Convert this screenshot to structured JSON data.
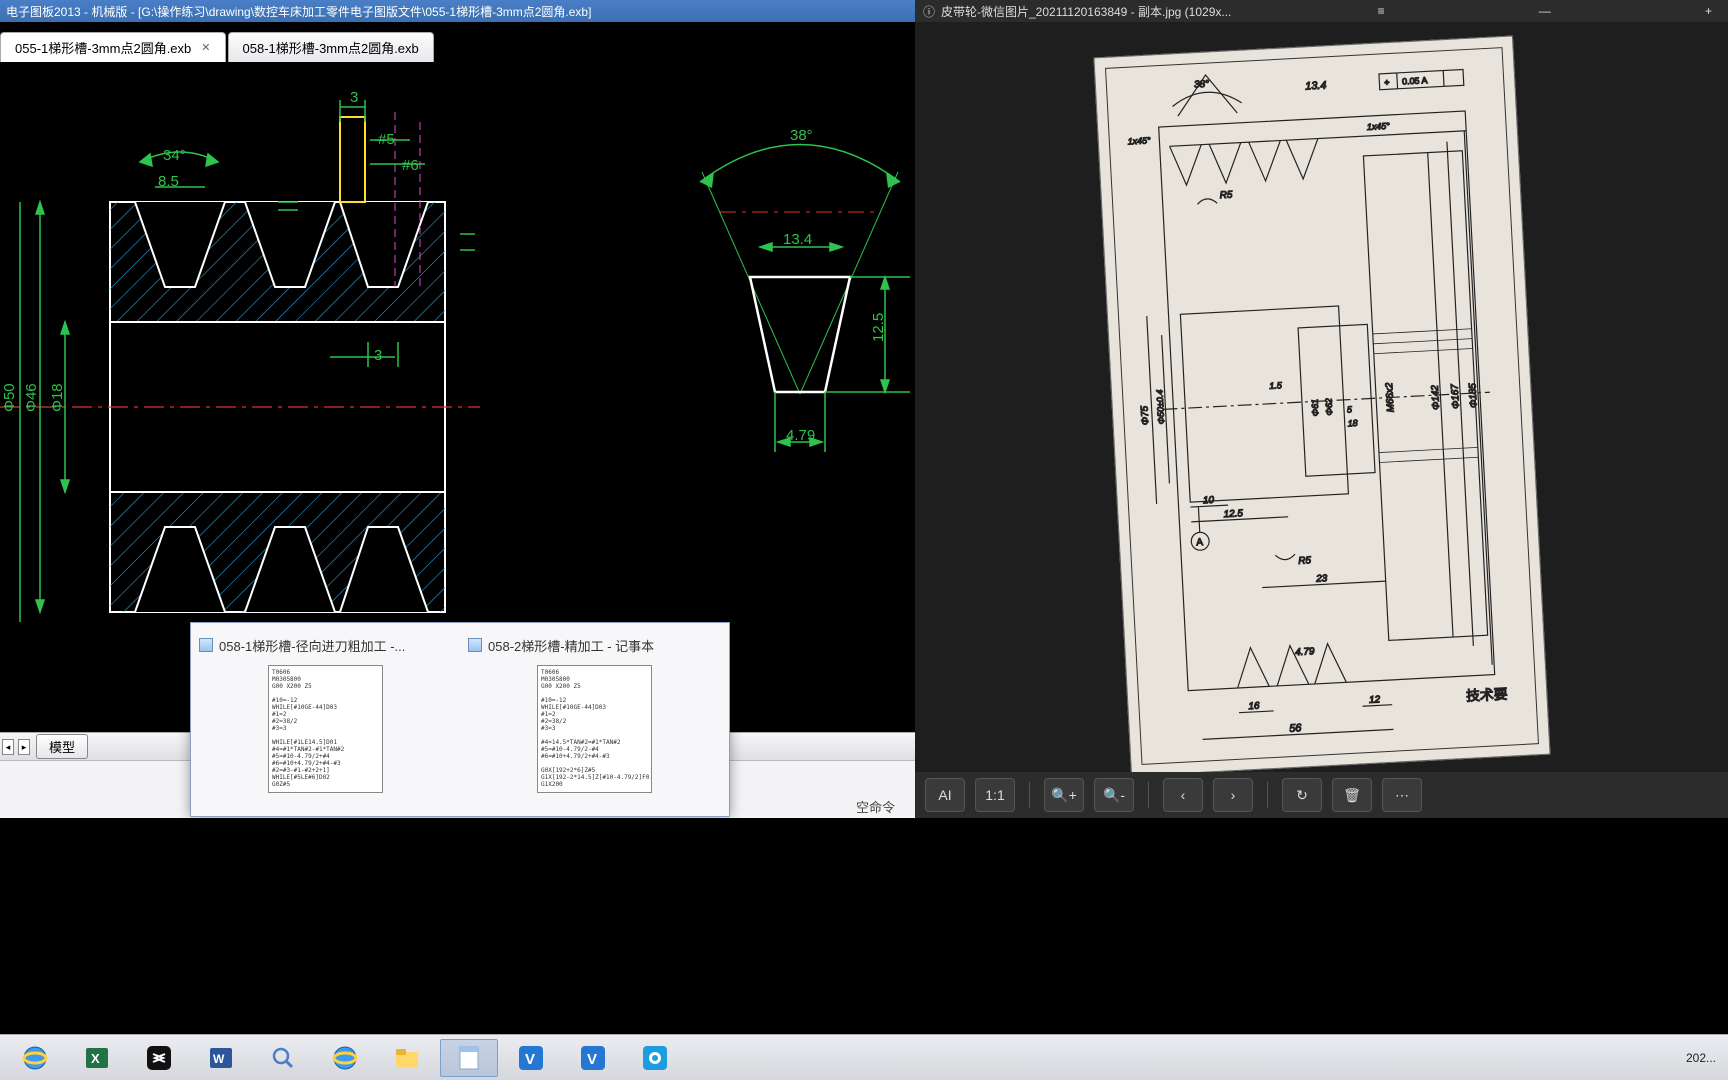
{
  "titlebar": {
    "left": "电子图板2013 - 机械版 - [G:\\操作练习\\drawing\\数控车床加工零件电子图版文件\\055-1梯形槽-3mm点2圆角.exb]",
    "right": "皮带轮-微信图片_20211120163849 - 副本.jpg (1029x..."
  },
  "tabs": [
    {
      "label": "055-1梯形槽-3mm点2圆角.exb",
      "active": true
    },
    {
      "label": "058-1梯形槽-3mm点2圆角.exb",
      "active": false
    }
  ],
  "modelbar": {
    "model_tab": "模型"
  },
  "cmdbar": {
    "label": "空命令"
  },
  "dimensions": {
    "d_top3": "3",
    "d_ph5": "#5",
    "d_ph6": "#6",
    "d_34": "34°",
    "d_85": "8.5",
    "d_38": "38°",
    "d_134": "13.4",
    "d_125": "12.5",
    "d_479": "4.79",
    "d_mid3": "3",
    "d_phi46": "Φ46",
    "d_phi50": "Φ50",
    "d_phi18": "Φ18"
  },
  "task_switcher": {
    "items": [
      {
        "title": "058-1梯形槽-径向进刀粗加工 -...",
        "code": "T0606\nM0305800\nG00 X200 Z5\n\n#10=-12\nWHILE[#10GE-44]D03\n#1=2\n#2=38/2\n#3=3\n\nWHILE[#1LE14.5]D01\n#4=#1*TAN#2-#1*TAN#2\n#5=#10-4.79/2+#4\n#6=#10+4.79/2+#4-#3\n#2=#3-#1-#2+2+1]\nWHILE[#5LE#6]D02\nG0Z#5"
      },
      {
        "title": "058-2梯形槽-精加工 - 记事本",
        "code": "T0606\nM0305800\nG00 X200 Z5\n\n#10=-12\nWHILE[#10GE-44]D03\n#1=2\n#2=38/2\n#3=3\n\n#4=14.5*TAN#2=#1*TAN#2\n#5=#10-4.79/2-#4\n#6=#10+4.79/2+#4-#3\n\nG0X[192+2*6]Z#5\nG1X[192-2*14.5]Z[#10-4.79/2]F0.2\nG1X200"
      }
    ]
  },
  "taskbar": {
    "icons": [
      "ie",
      "excel",
      "capcut",
      "word",
      "magnify",
      "ie2",
      "explorer",
      "notepad",
      "v1",
      "v2",
      "cam"
    ],
    "clock": "202..."
  },
  "viewer_toolbar": {
    "buttons": [
      "ai",
      "11",
      "zoom-in",
      "zoom-out",
      "prev",
      "next",
      "rotate",
      "delete",
      "more"
    ],
    "labels": {
      "ai": "AI",
      "11": "1:1"
    }
  },
  "paper_dims": {
    "d38": "38°",
    "d134": "13.4",
    "dtol": "0.05 A",
    "d1x45l": "1x45°",
    "d1x45r": "1x45°",
    "dR5": "R5",
    "dR5b": "R5",
    "d75": "Φ75",
    "d504": "Φ50±0.4",
    "d16l": "16",
    "d12r": "12",
    "d56": "56",
    "d10": "10",
    "d125": "12.5",
    "d23": "23",
    "dA": "A",
    "d479": "4.79",
    "d142": "Φ142",
    "d167": "Φ167",
    "d185": "Φ185",
    "d15": "1.5",
    "d5": "5",
    "d18": "18",
    "dm66": "M66x2",
    "d61": "Φ61",
    "d62": "Φ62",
    "tech": "技术要"
  }
}
